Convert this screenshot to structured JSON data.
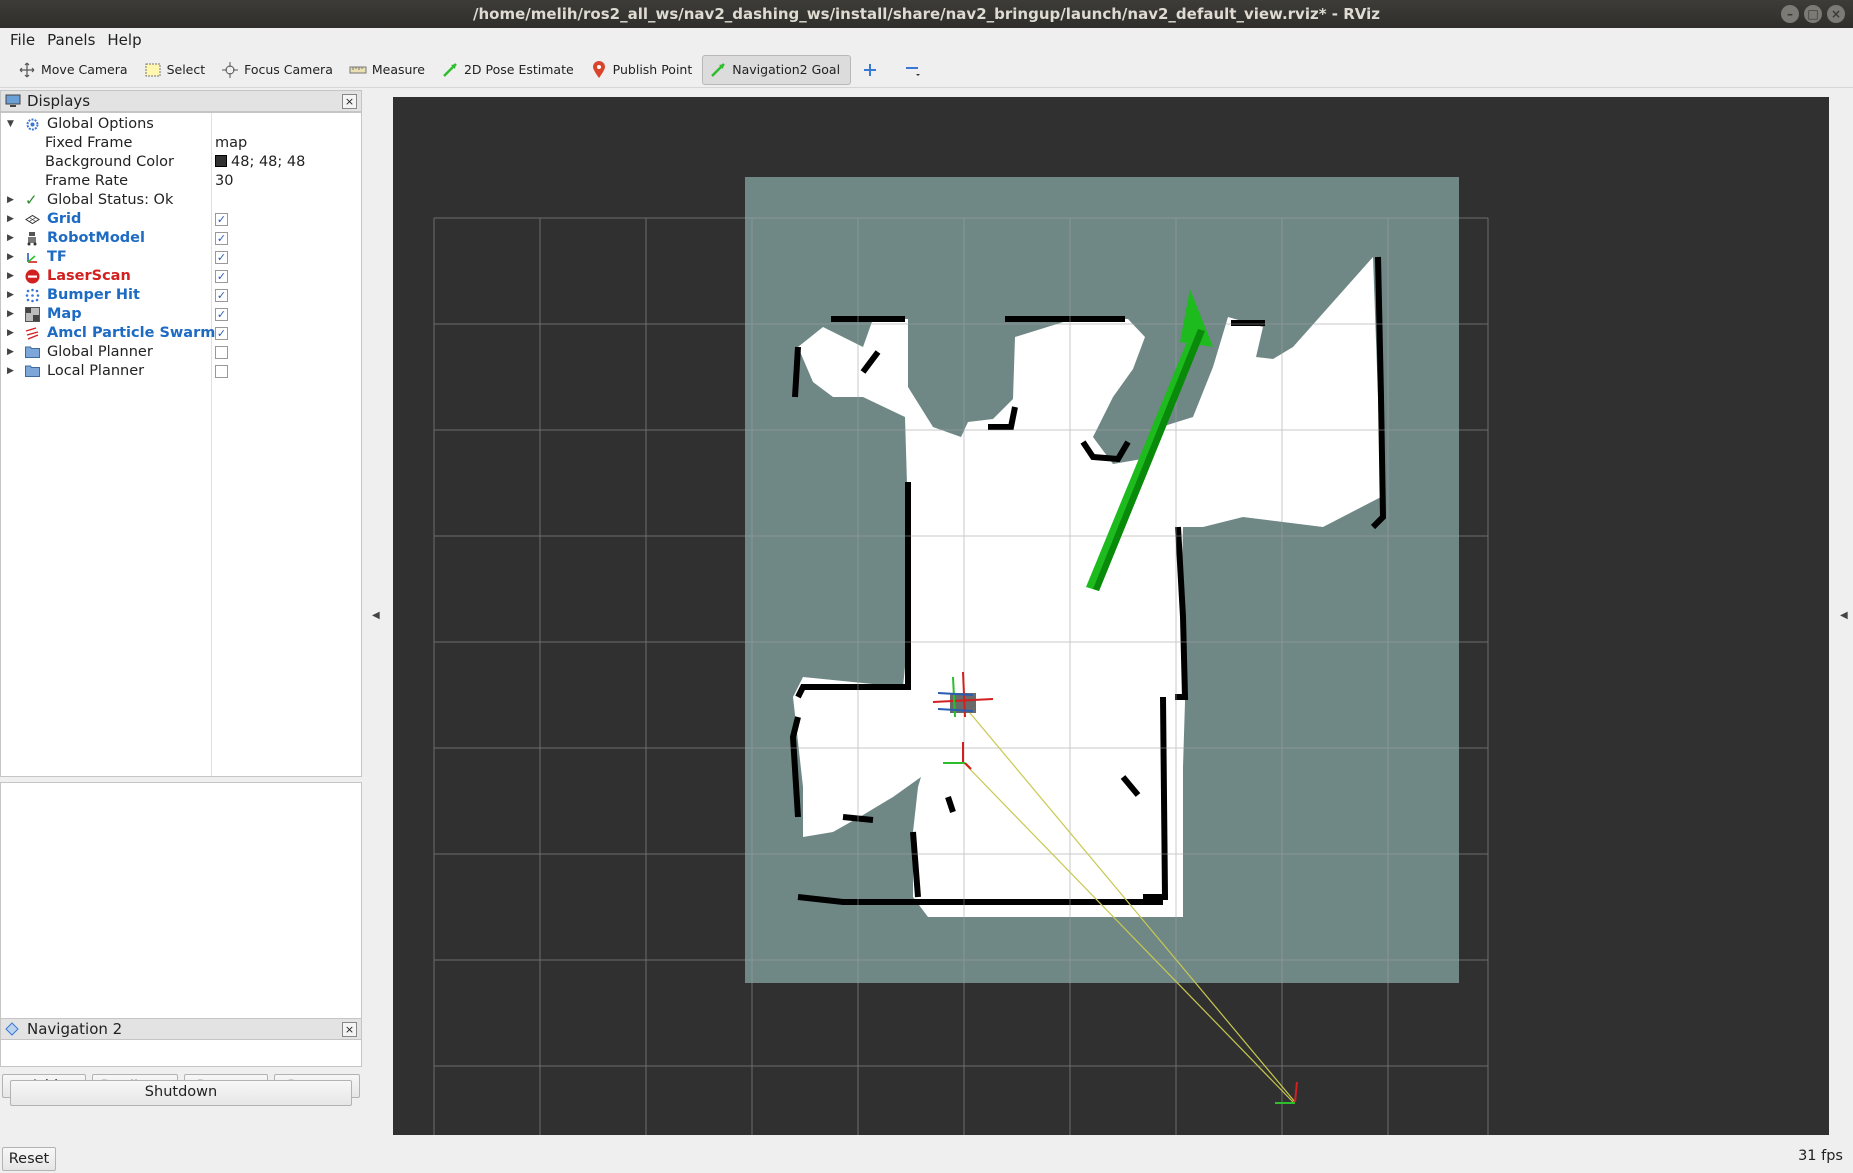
{
  "window": {
    "title": "/home/melih/ros2_all_ws/nav2_dashing_ws/install/share/nav2_bringup/launch/nav2_default_view.rviz* - RViz",
    "buttons": [
      "–",
      "□",
      "×"
    ]
  },
  "menubar": {
    "items": [
      "File",
      "Panels",
      "Help"
    ]
  },
  "toolbar": {
    "tools": [
      {
        "label": "Move Camera",
        "icon": "move-camera-icon"
      },
      {
        "label": "Select",
        "icon": "select-icon"
      },
      {
        "label": "Focus Camera",
        "icon": "focus-camera-icon"
      },
      {
        "label": "Measure",
        "icon": "measure-icon"
      },
      {
        "label": "2D Pose Estimate",
        "icon": "pose-estimate-icon"
      },
      {
        "label": "Publish Point",
        "icon": "publish-point-icon"
      },
      {
        "label": "Navigation2 Goal",
        "icon": "nav-goal-icon",
        "active": true
      }
    ],
    "add_tool_icon": "plus-icon",
    "remove_tool_icon": "minus-icon"
  },
  "displays_panel": {
    "title": "Displays",
    "global_options": {
      "label": "Global Options",
      "fixed_frame_label": "Fixed Frame",
      "fixed_frame_value": "map",
      "background_color_label": "Background Color",
      "background_color_value": "48; 48; 48",
      "background_color_hex": "#303030",
      "frame_rate_label": "Frame Rate",
      "frame_rate_value": "30"
    },
    "global_status": "Global Status: Ok",
    "items": [
      {
        "label": "Grid",
        "color": "blue",
        "checked": true,
        "icon": "grid-icon"
      },
      {
        "label": "RobotModel",
        "color": "blue",
        "checked": true,
        "icon": "robot-model-icon"
      },
      {
        "label": "TF",
        "color": "blue",
        "checked": true,
        "icon": "tf-icon"
      },
      {
        "label": "LaserScan",
        "color": "red",
        "checked": true,
        "icon": "error-icon"
      },
      {
        "label": "Bumper Hit",
        "color": "blue",
        "checked": true,
        "icon": "bumper-hit-icon"
      },
      {
        "label": "Map",
        "color": "blue",
        "checked": true,
        "icon": "map-icon"
      },
      {
        "label": "Amcl Particle Swarm",
        "color": "blue",
        "checked": true,
        "icon": "particle-swarm-icon"
      },
      {
        "label": "Global Planner",
        "color": "plain",
        "checked": false,
        "icon": "folder-icon"
      },
      {
        "label": "Local Planner",
        "color": "plain",
        "checked": false,
        "icon": "folder-icon"
      }
    ],
    "check_mark": "✓",
    "buttons": {
      "add": "Add",
      "duplicate": "Duplicate",
      "remove": "Remove",
      "rename": "Rename"
    }
  },
  "navigation_panel": {
    "title": "Navigation 2",
    "shutdown_label": "Shutdown"
  },
  "status": {
    "reset_label": "Reset",
    "fps": "31 fps"
  }
}
